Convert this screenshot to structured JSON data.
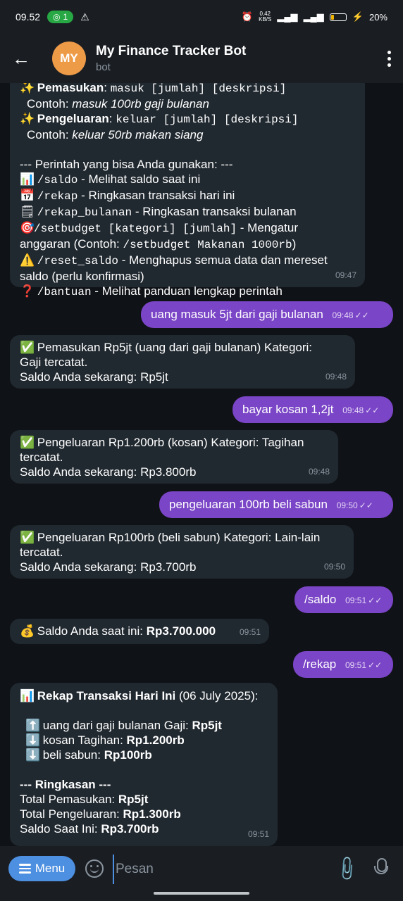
{
  "status_bar": {
    "time": "09.52",
    "hotspot_count": "1",
    "net_speed": "0,42",
    "net_unit": "KB/S",
    "battery": "20%",
    "battery_level": 0.2
  },
  "header": {
    "avatar_initials": "MY",
    "title": "My Finance Tracker Bot",
    "subtitle": "bot"
  },
  "messages": {
    "m1": {
      "l1_label": "Pemasukan",
      "l1_cmd": "masuk [jumlah] [deskripsi]",
      "l2_prefix": "Contoh:",
      "l2_example": "masuk 100rb gaji bulanan",
      "l3_label": "Pengeluaran",
      "l3_cmd": "keluar [jumlah] [deskripsi]",
      "l4_prefix": "Contoh:",
      "l4_example": "keluar 50rb makan siang",
      "l5": "--- Perintah yang bisa Anda gunakan: ---",
      "c1_cmd": "/saldo",
      "c1_desc": "- Melihat saldo saat ini",
      "c2_cmd": "/rekap",
      "c2_desc": "- Ringkasan transaksi hari ini",
      "c3_cmd": "/rekap_bulanan",
      "c3_desc": "- Ringkasan transaksi bulanan",
      "c4_cmd": "/setbudget [kategori] [jumlah]",
      "c4_desc": "- Mengatur",
      "c4_cont_a": "anggaran (Contoh:",
      "c4_cont_cmd": "/setbudget Makanan 1000rb",
      "c4_cont_b": ")",
      "c5_cmd": "/reset_saldo",
      "c5_desc": "- Menghapus semua data dan mereset",
      "c5_cont": "saldo (perlu konfirmasi)",
      "c6_cmd": "/bantuan",
      "c6_desc": "- Melihat panduan lengkap perintah",
      "time": "09:47"
    },
    "u1": {
      "text": "uang masuk 5jt dari gaji bulanan",
      "time": "09:48"
    },
    "m2": {
      "l1": "Pemasukan Rp5jt (uang   dari gaji bulanan) Kategori:",
      "l2": "Gaji tercatat.",
      "l3": "Saldo Anda sekarang: Rp5jt",
      "time": "09:48"
    },
    "u2": {
      "text": "bayar kosan 1,2jt",
      "time": "09:48"
    },
    "m3": {
      "l1": "Pengeluaran Rp1.200rb (kosan) Kategori: Tagihan",
      "l2": "tercatat.",
      "l3": "Saldo Anda sekarang: Rp3.800rb",
      "time": "09:48"
    },
    "u3": {
      "text": "pengeluaran 100rb beli sabun",
      "time": "09:50"
    },
    "m4": {
      "l1": "Pengeluaran Rp100rb (beli sabun) Kategori: Lain-lain",
      "l2": "tercatat.",
      "l3": "Saldo Anda sekarang: Rp3.700rb",
      "time": "09:50"
    },
    "u4": {
      "text": "/saldo",
      "time": "09:51"
    },
    "m5": {
      "label": "Saldo Anda saat ini:",
      "value": "Rp3.700.000",
      "time": "09:51"
    },
    "u5": {
      "text": "/rekap",
      "time": "09:51"
    },
    "m6": {
      "title": "Rekap Transaksi Hari Ini",
      "date": "(06 July 2025):",
      "r1_desc": "uang   dari gaji bulanan Gaji:",
      "r1_val": "Rp5jt",
      "r2_desc": "kosan Tagihan:",
      "r2_val": "Rp1.200rb",
      "r3_desc": "beli sabun:",
      "r3_val": "Rp100rb",
      "summary_title": "--- Ringkasan ---",
      "s1_label": "Total Pemasukan:",
      "s1_val": "Rp5jt",
      "s2_label": "Total Pengeluaran:",
      "s2_val": "Rp1.300rb",
      "s3_label": "Saldo Saat Ini:",
      "s3_val": "Rp3.700rb",
      "time": "09:51"
    }
  },
  "composer": {
    "menu_label": "Menu",
    "placeholder": "Pesan"
  },
  "colors": {
    "outgoing_bubble": "#7a45c6",
    "incoming_bubble": "#212930",
    "menu_button": "#4d8fe0",
    "avatar": "#ee9b48"
  }
}
